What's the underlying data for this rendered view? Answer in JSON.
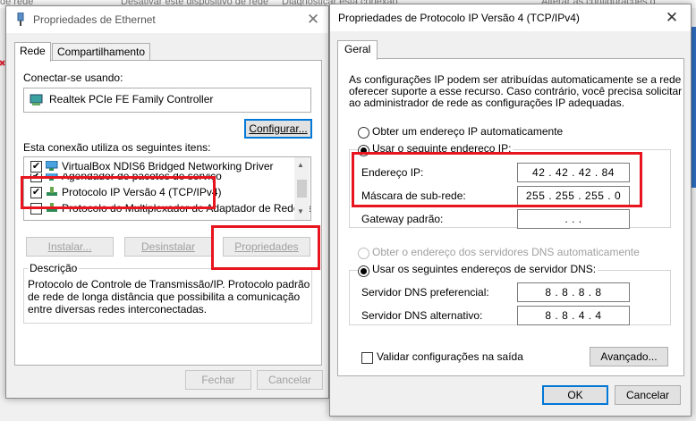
{
  "background": {
    "strip_texts": [
      "de rede",
      "Desativar este dispositivo de rede",
      "Diagnosticar esta conexão",
      "Alterar as configurações d"
    ]
  },
  "ethernet_window": {
    "title": "Propriedades de Ethernet",
    "tabs": [
      {
        "label": "Rede",
        "active": true
      },
      {
        "label": "Compartilhamento",
        "active": false
      }
    ],
    "connect_using_label": "Conectar-se usando:",
    "adapter_name": "Realtek PCIe FE Family Controller",
    "configure_button": "Configurar...",
    "items_label": "Esta conexão utiliza os seguintes itens:",
    "items": [
      {
        "label": "VirtualBox NDIS6 Bridged Networking Driver",
        "checked": true
      },
      {
        "label": "Agendador de pacotes de serviço",
        "checked": true
      },
      {
        "label": "Protocolo IP Versão 4 (TCP/IPv4)",
        "checked": true
      },
      {
        "label": "Protocolo do Multiplexador de Adaptador de Rede da M",
        "checked": false
      }
    ],
    "install_button": "Instalar...",
    "uninstall_button": "Desinstalar",
    "properties_button": "Propriedades",
    "description_title": "Descrição",
    "description_text": [
      "Protocolo de Controle de Transmissão/IP. Protocolo padrão",
      "de rede de longa distância que possibilita a comunicação",
      "entre diversas redes interconectadas."
    ],
    "close_button": "Fechar",
    "cancel_button": "Cancelar"
  },
  "ipv4_window": {
    "title": "Propriedades de Protocolo IP Versão 4 (TCP/IPv4)",
    "tab_label": "Geral",
    "intro_text": [
      "As configurações IP podem ser atribuídas automaticamente se a rede",
      "oferecer suporte a esse recurso. Caso contrário, você precisa solicitar",
      "ao administrador de rede as configurações IP adequadas."
    ],
    "obtain_ip_auto_label": "Obter um endereço IP automaticamente",
    "use_ip_label": "Usar o seguinte endereço IP:",
    "ip_address_label": "Endereço IP:",
    "ip_address_value": "42 . 42 . 42 . 84",
    "subnet_mask_label": "Máscara de sub-rede:",
    "subnet_mask_value": "255 . 255 . 255 . 0",
    "gateway_label": "Gateway padrão:",
    "gateway_value": ". . .",
    "obtain_dns_auto_label": "Obter o endereço dos servidores DNS automaticamente",
    "use_dns_label": "Usar os seguintes endereços de servidor DNS:",
    "preferred_dns_label": "Servidor DNS preferencial:",
    "preferred_dns_value": "8 . 8 . 8 . 8",
    "alternate_dns_label": "Servidor DNS alternativo:",
    "alternate_dns_value": "8 . 8 . 4 . 4",
    "validate_label": "Validar configurações na saída",
    "advanced_button": "Avançado...",
    "ok_button": "OK",
    "cancel_button": "Cancelar"
  },
  "colors": {
    "highlight_red": "#e8141e",
    "focus_blue": "#0078d7"
  }
}
